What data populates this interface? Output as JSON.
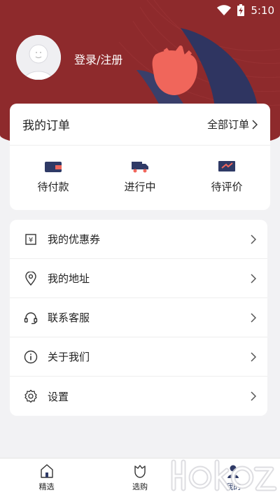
{
  "status_bar": {
    "time": "5:10"
  },
  "profile": {
    "login_label": "登录/注册"
  },
  "orders": {
    "title": "我的订单",
    "all_label": "全部订单",
    "items": [
      {
        "label": "待付款",
        "icon": "wallet-icon"
      },
      {
        "label": "进行中",
        "icon": "truck-icon"
      },
      {
        "label": "待评价",
        "icon": "review-icon"
      }
    ]
  },
  "menu": {
    "items": [
      {
        "label": "我的优惠券",
        "icon": "coupon-icon"
      },
      {
        "label": "我的地址",
        "icon": "location-pin-icon"
      },
      {
        "label": "联系客服",
        "icon": "headset-icon"
      },
      {
        "label": "关于我们",
        "icon": "info-icon"
      },
      {
        "label": "设置",
        "icon": "gear-icon"
      }
    ]
  },
  "tabbar": {
    "items": [
      {
        "label": "精选",
        "icon": "home-icon"
      },
      {
        "label": "选购",
        "icon": "tulip-icon"
      },
      {
        "label": "我的",
        "icon": "person-icon",
        "active": true
      }
    ]
  },
  "colors": {
    "header": "#8e2a2c",
    "accent_navy": "#2f3a66",
    "flower": "#f0665b"
  }
}
